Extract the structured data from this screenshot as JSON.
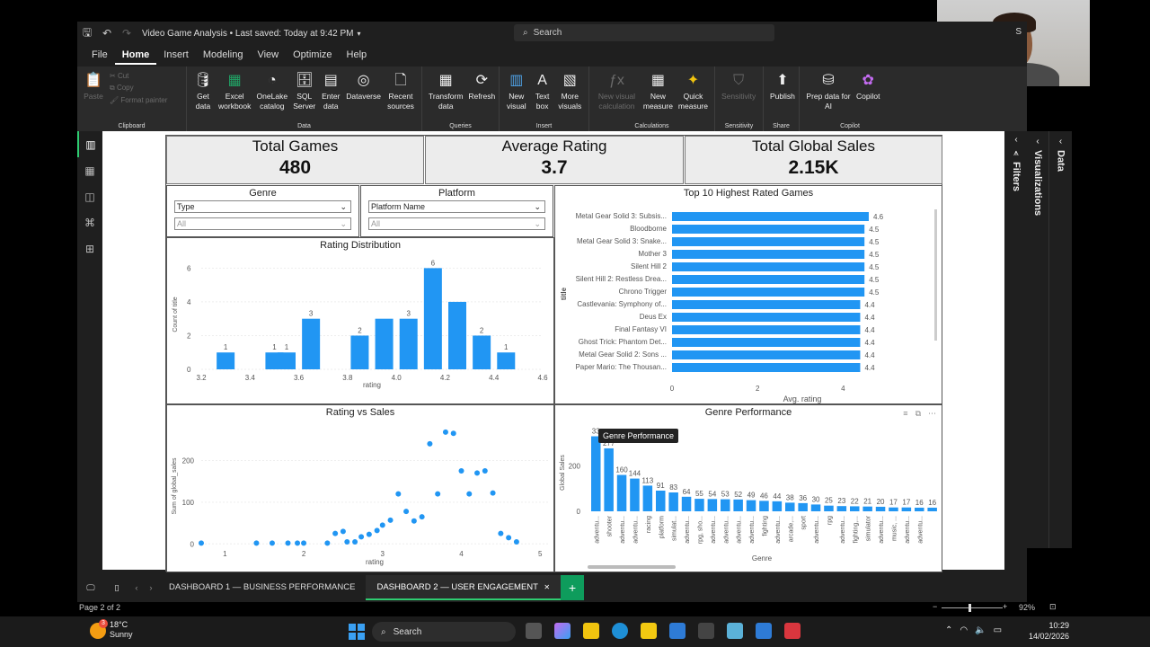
{
  "window": {
    "doc_title": "Video Game Analysis • Last saved: Today at 9:42 PM",
    "search_placeholder": "Search",
    "user_initial": "S"
  },
  "menu": [
    "File",
    "Home",
    "Insert",
    "Modeling",
    "View",
    "Optimize",
    "Help"
  ],
  "menu_active": "Home",
  "ribbon": {
    "clipboard": {
      "paste": "Paste",
      "cut": "Cut",
      "copy": "Copy",
      "format_painter": "Format painter",
      "group": "Clipboard"
    },
    "data": {
      "group": "Data",
      "buttons": [
        "Get data",
        "Excel workbook",
        "OneLake catalog",
        "SQL Server",
        "Enter data",
        "Dataverse",
        "Recent sources"
      ]
    },
    "queries": {
      "group": "Queries",
      "buttons": [
        "Transform data",
        "Refresh"
      ]
    },
    "insert": {
      "group": "Insert",
      "buttons": [
        "New visual",
        "Text box",
        "More visuals"
      ]
    },
    "calculations": {
      "group": "Calculations",
      "buttons": [
        "New visual calculation",
        "New measure",
        "Quick measure"
      ]
    },
    "sensitivity": {
      "group": "Sensitivity",
      "buttons": [
        "Sensitivity"
      ]
    },
    "share": {
      "group": "Share",
      "buttons": [
        "Publish"
      ]
    },
    "copilot": {
      "group": "Copilot",
      "buttons": [
        "Prep data for AI",
        "Copilot"
      ]
    }
  },
  "panes": {
    "filters": "Filters",
    "visualizations": "Visualizations",
    "data": "Data"
  },
  "cards": [
    {
      "title": "Total Games",
      "value": "480"
    },
    {
      "title": "Average Rating",
      "value": "3.7"
    },
    {
      "title": "Total Global Sales",
      "value": "2.15K"
    }
  ],
  "slicers": [
    {
      "title": "Genre",
      "field": "Type",
      "value": "All"
    },
    {
      "title": "Platform",
      "field": "Platform Name",
      "value": "All"
    }
  ],
  "tooltip": "Genre Performance",
  "chart_data": [
    {
      "type": "bar",
      "title": "Rating Distribution",
      "xlabel": "rating",
      "ylabel": "Count of title",
      "x": [
        3.3,
        3.5,
        3.55,
        3.65,
        3.85,
        3.95,
        4.05,
        4.15,
        4.25,
        4.35,
        4.45
      ],
      "values": [
        1,
        1,
        1,
        3,
        2,
        3,
        3,
        6,
        4,
        2,
        1
      ],
      "labels": [
        "1",
        "1",
        "1",
        "3",
        "2",
        "",
        "3",
        "6",
        "",
        "2",
        "1"
      ],
      "xlim": [
        3.2,
        4.6
      ],
      "ylim": [
        0,
        6.5
      ],
      "xticks": [
        "3.2",
        "3.4",
        "3.6",
        "3.8",
        "4.0",
        "4.2",
        "4.4",
        "4.6"
      ],
      "yticks": [
        "0",
        "2",
        "4",
        "6"
      ],
      "color": "#2196f3"
    },
    {
      "type": "bar",
      "orientation": "horizontal",
      "title": "Top 10 Highest Rated Games",
      "xlabel": "Avg. rating",
      "ylabel": "title",
      "categories": [
        "Metal Gear Solid 3: Subsis...",
        "Bloodborne",
        "Metal Gear Solid 3: Snake...",
        "Mother 3",
        "Silent Hill 2",
        "Silent Hill 2: Restless Drea...",
        "Chrono Trigger",
        "Castlevania: Symphony of...",
        "Deus Ex",
        "Final Fantasy VI",
        "Ghost Trick: Phantom Det...",
        "Metal Gear Solid 2: Sons ...",
        "Paper Mario: The Thousan..."
      ],
      "values": [
        4.6,
        4.5,
        4.5,
        4.5,
        4.5,
        4.5,
        4.5,
        4.4,
        4.4,
        4.4,
        4.4,
        4.4,
        4.4
      ],
      "xlim": [
        0,
        5
      ],
      "xticks": [
        "0",
        "2",
        "4"
      ],
      "color": "#2196f3"
    },
    {
      "type": "scatter",
      "title": "Rating vs Sales",
      "xlabel": "rating",
      "ylabel": "Sum of global_sales",
      "xlim": [
        0.7,
        5.1
      ],
      "ylim": [
        -8,
        285
      ],
      "xticks": [
        "1",
        "2",
        "3",
        "4",
        "5"
      ],
      "yticks": [
        "0",
        "100",
        "200"
      ],
      "points": [
        [
          0.7,
          2
        ],
        [
          1.4,
          2
        ],
        [
          1.6,
          2
        ],
        [
          1.8,
          2
        ],
        [
          1.92,
          2
        ],
        [
          2.0,
          2
        ],
        [
          2.3,
          2
        ],
        [
          2.4,
          25
        ],
        [
          2.5,
          30
        ],
        [
          2.55,
          5
        ],
        [
          2.65,
          5
        ],
        [
          2.73,
          17
        ],
        [
          2.83,
          23
        ],
        [
          2.93,
          32
        ],
        [
          3.0,
          45
        ],
        [
          3.1,
          57
        ],
        [
          3.2,
          120
        ],
        [
          3.3,
          78
        ],
        [
          3.4,
          55
        ],
        [
          3.5,
          65
        ],
        [
          3.6,
          240
        ],
        [
          3.7,
          120
        ],
        [
          3.8,
          268
        ],
        [
          3.9,
          265
        ],
        [
          4.0,
          175
        ],
        [
          4.1,
          120
        ],
        [
          4.2,
          170
        ],
        [
          4.3,
          175
        ],
        [
          4.4,
          122
        ],
        [
          4.5,
          25
        ],
        [
          4.6,
          15
        ],
        [
          4.7,
          5
        ]
      ],
      "color": "#2196f3"
    },
    {
      "type": "bar",
      "title": "Genre Performance",
      "xlabel": "Genre",
      "ylabel": "Global Sales",
      "categories": [
        "adventu...",
        "shooter",
        "adventu...",
        "adventu...",
        "racing",
        "platform",
        "simulat...",
        "adventu...",
        "rpg, sho...",
        "adventu...",
        "adventu...",
        "adventu...",
        "adventu...",
        "fighting",
        "adventu...",
        "arcade,...",
        "sport",
        "adventu...",
        "rpg",
        "adventu...",
        "fighting,...",
        "simulator",
        "adventu...",
        "music, ...",
        "adventu...",
        "adventu..."
      ],
      "values": [
        330,
        277,
        160,
        144,
        113,
        91,
        83,
        64,
        55,
        54,
        53,
        52,
        49,
        46,
        44,
        38,
        36,
        30,
        25,
        23,
        22,
        21,
        20,
        17,
        17,
        16,
        16
      ],
      "labels": [
        "33",
        "277",
        "160",
        "144",
        "113",
        "91",
        "83",
        "64",
        "55",
        "54",
        "53",
        "52",
        "49",
        "46",
        "44",
        "38",
        "36",
        "30",
        "25",
        "23",
        "22",
        "21",
        "20",
        "17",
        "17",
        "16",
        "16"
      ],
      "ylim": [
        0,
        340
      ],
      "yticks": [
        "0",
        "200"
      ],
      "color": "#2196f3"
    }
  ],
  "page_tabs": [
    "DASHBOARD 1 — BUSINESS PERFORMANCE",
    "DASHBOARD 2 — USER ENGAGEMENT"
  ],
  "active_tab": 1,
  "status": {
    "page": "Page 2 of 2",
    "zoom": "92%"
  },
  "taskbar": {
    "weather_temp": "18°C",
    "weather_desc": "Sunny",
    "search": "Search",
    "time": "10:29",
    "date": "14/02/2026",
    "badge": "3"
  }
}
